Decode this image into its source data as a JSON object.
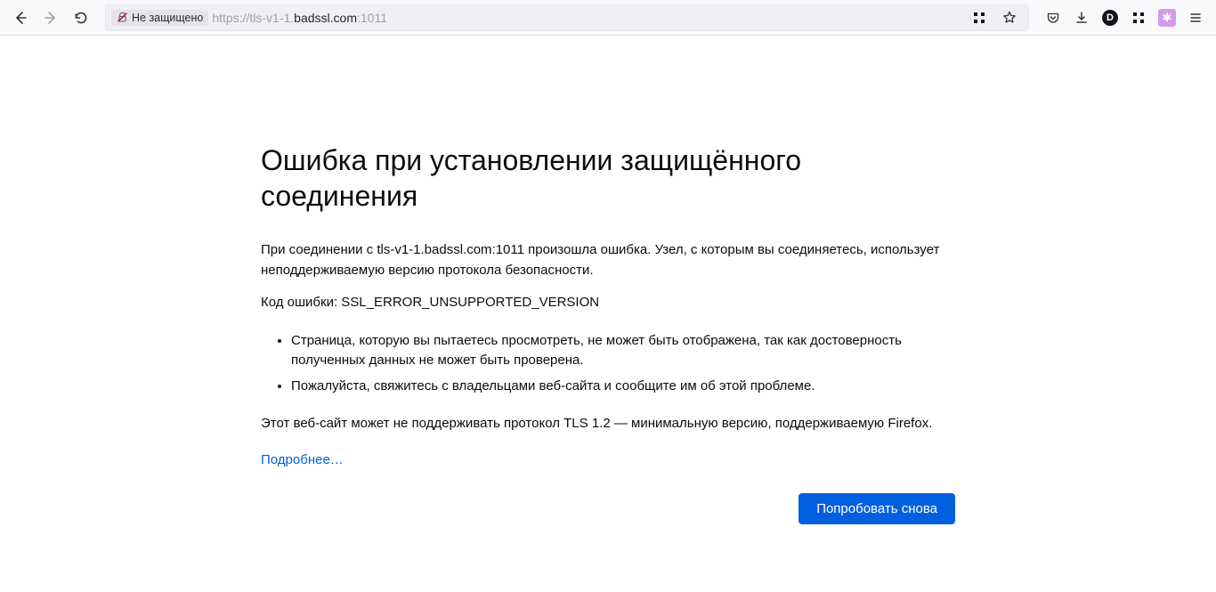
{
  "toolbar": {
    "security_label": "Не защищено",
    "url_prefix": "https://tls-v1-1.",
    "url_host": "badssl.com",
    "url_suffix": ":1011"
  },
  "error": {
    "title": "Ошибка при установлении защищённого соединения",
    "para1": "При соединении с tls-v1-1.badssl.com:1011 произошла ошибка. Узел, с которым вы соединяетесь, использует неподдерживаемую версию протокола безопасности.",
    "para2": "Код ошибки: SSL_ERROR_UNSUPPORTED_VERSION",
    "bullet1": "Страница, которую вы пытаетесь просмотреть, не может быть отображена, так как достоверность полученных данных не может быть проверена.",
    "bullet2": "Пожалуйста, свяжитесь с владельцами веб-сайта и сообщите им об этой проблеме.",
    "para3": "Этот веб-сайт может не поддерживать протокол TLS 1.2 — минимальную версию, поддерживаемую Firefox.",
    "learn_more": "Подробнее…",
    "retry": "Попробовать снова"
  }
}
